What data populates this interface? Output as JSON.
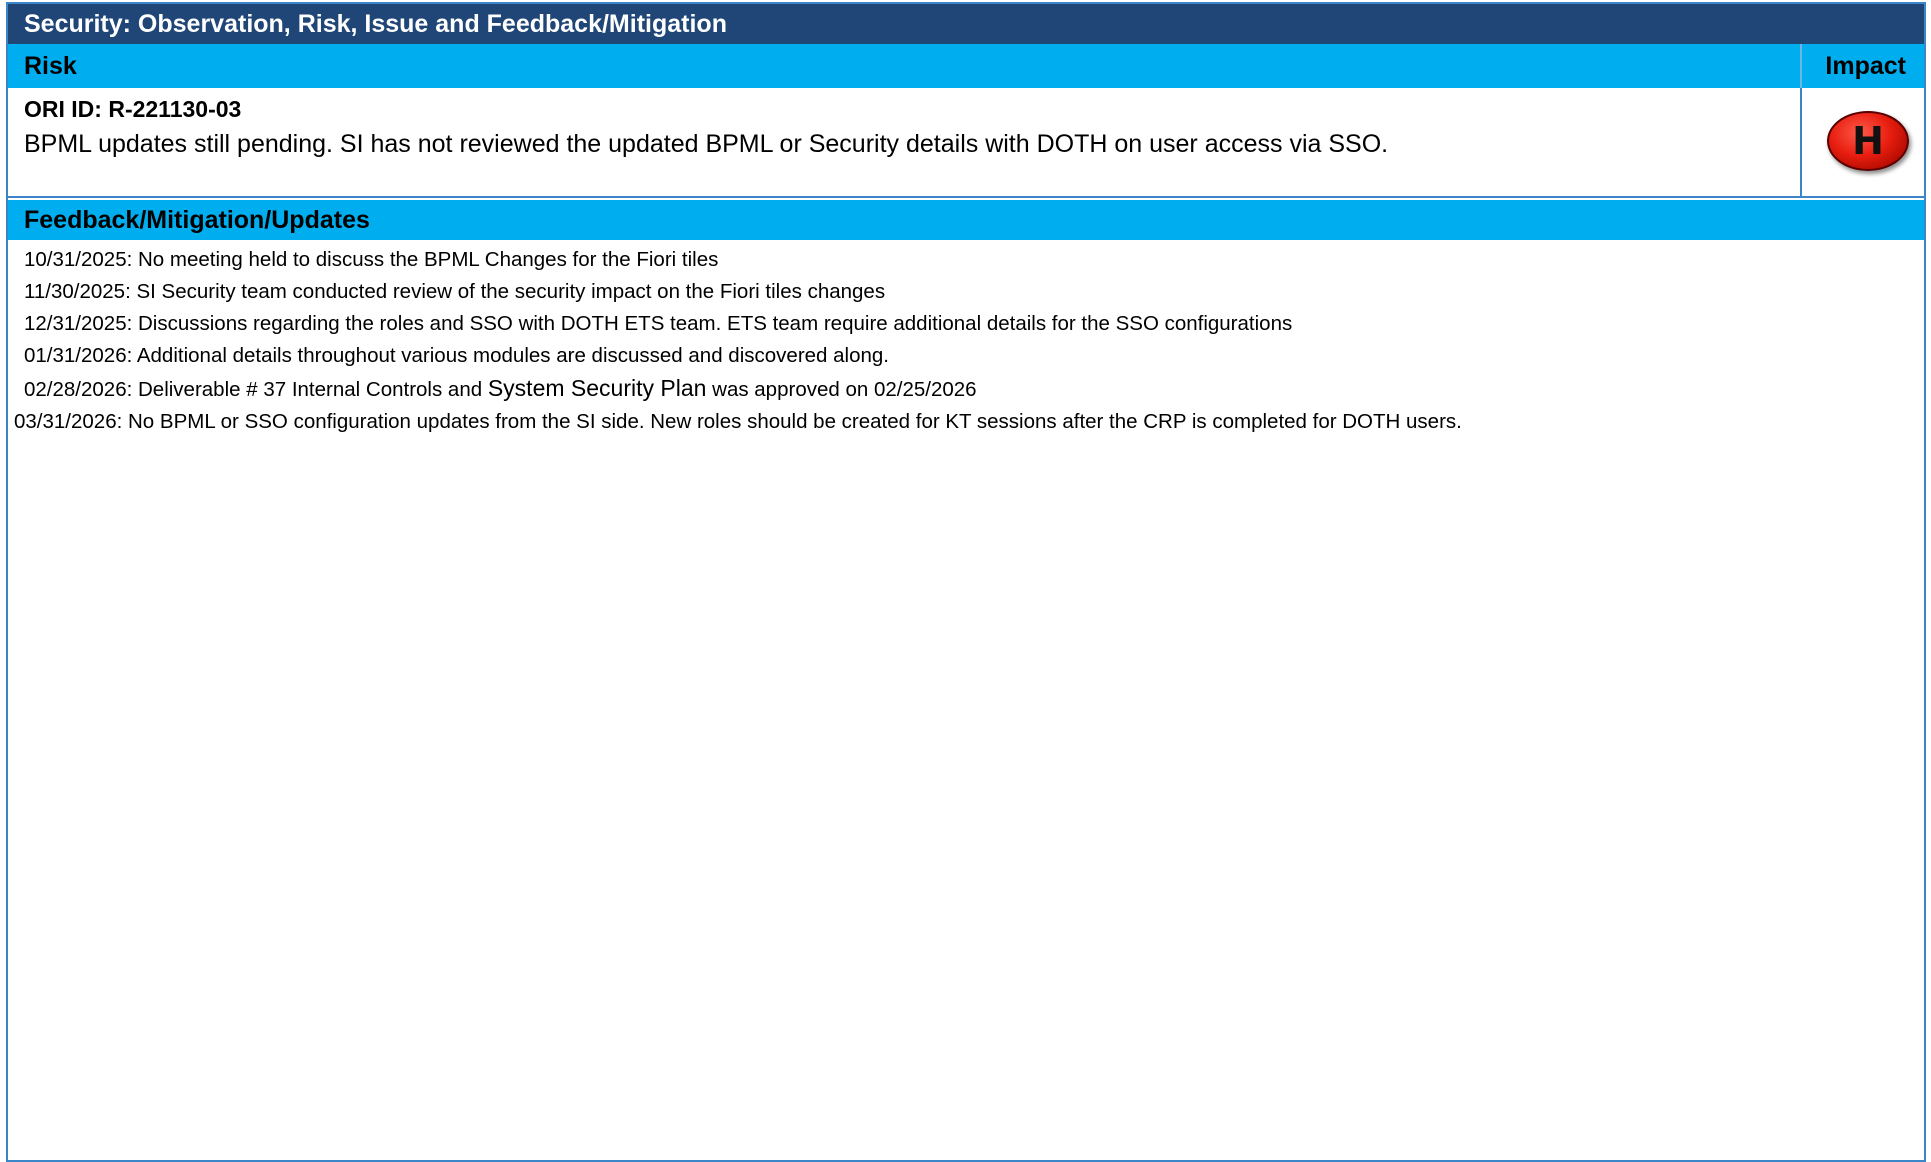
{
  "title": "Security: Observation, Risk, Issue and Feedback/Mitigation",
  "risk_section": {
    "risk_label": "Risk",
    "impact_label": "Impact",
    "ori_id": "ORI ID: R-221130-03",
    "description": "BPML updates still pending.  SI has not reviewed the updated BPML or Security details with DOTH on user access via SSO.",
    "impact_badge": "H",
    "impact_color": "#e81e10"
  },
  "feedback_section": {
    "header": "Feedback/Mitigation/Updates",
    "updates": [
      "10/31/2025: No meeting held to discuss the BPML Changes for the Fiori tiles",
      "11/30/2025: SI Security team conducted review of the security impact on the Fiori tiles changes",
      "12/31/2025: Discussions regarding the roles and SSO with DOTH ETS team.  ETS team require additional details for the SSO configurations",
      "01/31/2026: Additional details throughout various modules are discussed and discovered along."
    ],
    "update5": {
      "part1": "02/28/2026: Deliverable # 37 Internal Controls and ",
      "part2": "System Security Plan",
      "part3": " was approved on 02/25/2026"
    },
    "update6": "03/31/2026:  No BPML or SSO configuration updates from the SI side. New roles should be created for KT sessions after the CRP is completed for DOTH users."
  },
  "colors": {
    "title_bar": "#1f4677",
    "section_header": "#00aeef",
    "border": "#3a86c8"
  }
}
